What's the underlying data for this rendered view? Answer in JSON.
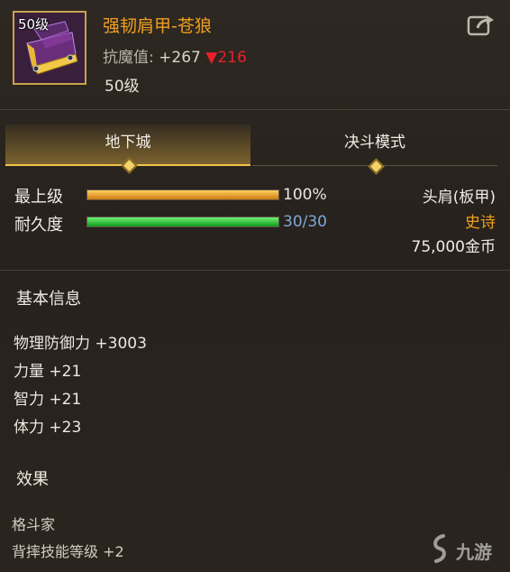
{
  "item": {
    "level_tag": "50级",
    "name": "强韧肩甲-苍狼",
    "stat_label": "抗魔值:",
    "stat_value": "+267",
    "stat_diff": "▼216",
    "required_level": "50级"
  },
  "tabs": [
    {
      "label": "地下城",
      "active": true
    },
    {
      "label": "决斗模式",
      "active": false
    }
  ],
  "bars": {
    "level": {
      "label": "最上级",
      "value_text": "100%",
      "fraction": 1.0
    },
    "durability": {
      "label": "耐久度",
      "value_text": "30/30",
      "fraction": 1.0
    }
  },
  "item_info": {
    "slot": "头肩(板甲)",
    "rarity": "史诗",
    "price": "75,000金币"
  },
  "basic_info": {
    "title": "基本信息",
    "attributes": [
      "物理防御力 +3003",
      "力量 +21",
      "智力 +21",
      "体力 +23"
    ]
  },
  "effects": {
    "title": "效果",
    "lines": [
      "格斗家",
      "背摔技能等级 +2"
    ]
  },
  "watermark": {
    "text": "九游"
  },
  "colors": {
    "item_name": "#f0a020",
    "rarity": "#f0a020",
    "stat_diff": "#e8202a",
    "durability_value": "#7fa8d8",
    "tab_accent": "#f2c24a"
  },
  "icons": [
    "share-icon",
    "shoulder-armor-icon",
    "diamond-marker-icon"
  ]
}
